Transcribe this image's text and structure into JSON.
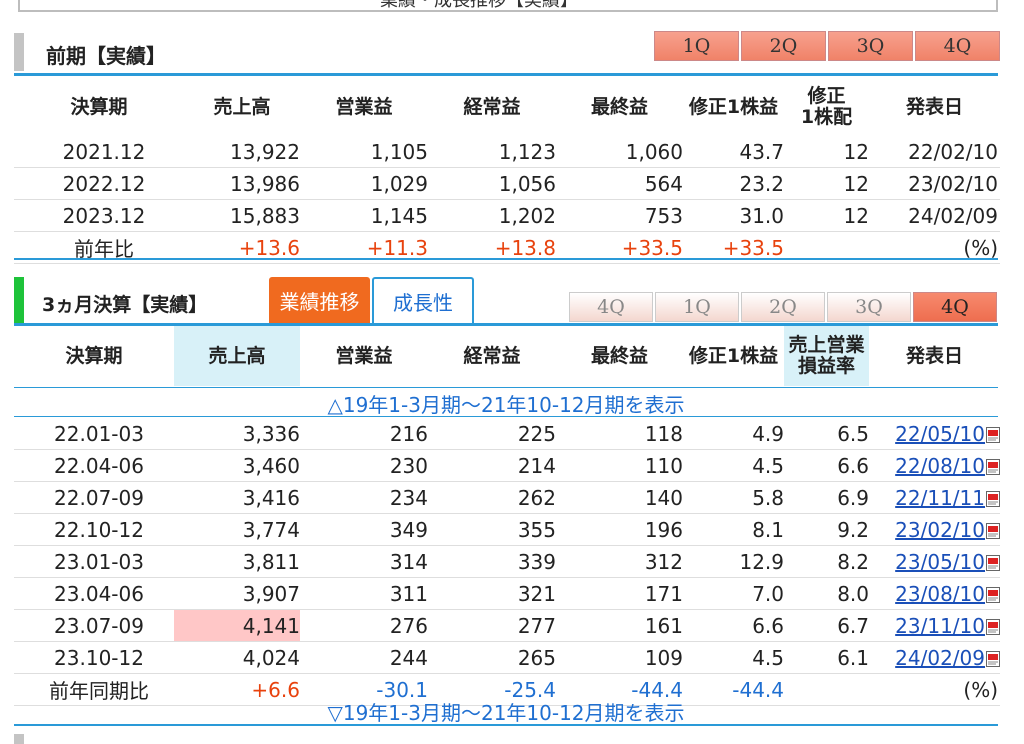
{
  "top_section": {
    "clipped_title": "業績・成長推移【実績】"
  },
  "annual": {
    "title": "前期【実績】",
    "quarter_buttons": [
      "1Q",
      "2Q",
      "3Q",
      "4Q"
    ],
    "headers": [
      "決算期",
      "売上高",
      "営業益",
      "経常益",
      "最終益",
      "修正1株益",
      "修正\n1株配",
      "発表日"
    ],
    "header_l1": [
      "決算期",
      "売上高",
      "営業益",
      "経常益",
      "最終益",
      "修正1株益",
      "修正",
      "発表日"
    ],
    "header_l2": [
      "",
      "",
      "",
      "",
      "",
      "",
      "1株配",
      ""
    ],
    "rows": [
      [
        "2021.12",
        "13,922",
        "1,105",
        "1,123",
        "1,060",
        "43.7",
        "12",
        "22/02/10"
      ],
      [
        "2022.12",
        "13,986",
        "1,029",
        "1,056",
        "564",
        "23.2",
        "12",
        "23/02/10"
      ],
      [
        "2023.12",
        "15,883",
        "1,145",
        "1,202",
        "753",
        "31.0",
        "12",
        "24/02/09"
      ]
    ],
    "yoy": {
      "label": "前年比",
      "values": [
        "+13.6",
        "+11.3",
        "+13.8",
        "+33.5",
        "+33.5"
      ],
      "unit": "(%)"
    }
  },
  "quarterly": {
    "title": "3ヵ月決算【実績】",
    "tabs": {
      "active": "業績推移",
      "inactive": "成長性"
    },
    "quarter_buttons": [
      "4Q",
      "1Q",
      "2Q",
      "3Q",
      "4Q"
    ],
    "header_l1": [
      "決算期",
      "売上高",
      "営業益",
      "経常益",
      "最終益",
      "修正1株益",
      "売上営業",
      "発表日"
    ],
    "header_l2": [
      "",
      "",
      "",
      "",
      "",
      "",
      "損益率",
      ""
    ],
    "toggle_up": "△19年1-3月期〜21年10-12月期を表示",
    "toggle_down": "▽19年1-3月期〜21年10-12月期を表示",
    "rows": [
      [
        "22.01-03",
        "3,336",
        "216",
        "225",
        "118",
        "4.9",
        "6.5",
        "22/05/10"
      ],
      [
        "22.04-06",
        "3,460",
        "230",
        "214",
        "110",
        "4.5",
        "6.6",
        "22/08/10"
      ],
      [
        "22.07-09",
        "3,416",
        "234",
        "262",
        "140",
        "5.8",
        "6.9",
        "22/11/11"
      ],
      [
        "22.10-12",
        "3,774",
        "349",
        "355",
        "196",
        "8.1",
        "9.2",
        "23/02/10"
      ],
      [
        "23.01-03",
        "3,811",
        "314",
        "339",
        "312",
        "12.9",
        "8.2",
        "23/05/10"
      ],
      [
        "23.04-06",
        "3,907",
        "311",
        "321",
        "171",
        "7.0",
        "8.0",
        "23/08/10"
      ],
      [
        "23.07-09",
        "4,141",
        "276",
        "277",
        "161",
        "6.6",
        "6.7",
        "23/11/10"
      ],
      [
        "23.10-12",
        "4,024",
        "244",
        "265",
        "109",
        "4.5",
        "6.1",
        "24/02/09"
      ]
    ],
    "yoy": {
      "label": "前年同期比",
      "values": [
        "+6.6",
        "-30.1",
        "-25.4",
        "-44.4",
        "-44.4"
      ],
      "unit": "(%)"
    }
  },
  "colors": {
    "accent_blue": "#2a9ad8",
    "positive_red": "#e8420d",
    "negative_blue": "#1f6fd1",
    "tab_orange": "#f06a1f",
    "highlight_pink": "#ffc7c7",
    "highlight_cyan": "#d8f1f8"
  }
}
